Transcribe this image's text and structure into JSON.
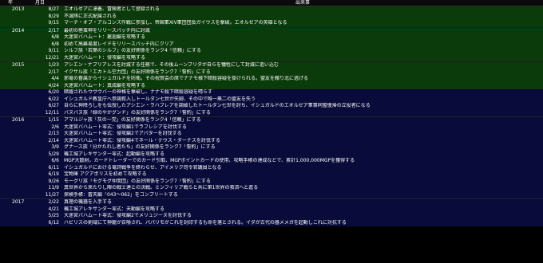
{
  "headers": {
    "year": "年",
    "date": "月日",
    "event": "出来事"
  },
  "colors": {
    "era_green": "#0b3a0b",
    "era_blue": "#090c3a",
    "background": "#000000"
  },
  "rows": [
    {
      "year": "2013",
      "date": "8/27",
      "event": "エオルゼアに漂着、冒険者として登録される",
      "era": "green"
    },
    {
      "year": "",
      "date": "8/29",
      "event": "不滅隊に正式配属される",
      "era": "green"
    },
    {
      "year": "",
      "date": "9/15",
      "event": "マーチ・オブ・アルコンズ作戦に参加し、帝国軍XIV軍団団長ガイウスを撃破。エオルゼアの英雄となる",
      "era": "green"
    },
    {
      "year": "2014",
      "date": "2/17",
      "event": "最初の極蛮神をリリースパッチ内に討滅",
      "era": "green"
    },
    {
      "year": "",
      "date": "6/8",
      "event": "大迷宮バハムート：邂逅編を攻略する",
      "era": "green"
    },
    {
      "year": "",
      "date": "6/8",
      "event": "初めて高難易度レイドをリリースパッチ内にクリア",
      "era": "green"
    },
    {
      "year": "",
      "date": "9/11",
      "event": "シルフ族「若葉のシルフ」の友好関係をランク4「信頼」にする",
      "era": "green"
    },
    {
      "year": "",
      "date": "12/21",
      "event": "大迷宮バハムート：侵攻編を攻略する",
      "era": "green"
    },
    {
      "year": "2015",
      "date": "1/23",
      "event": "アシエン・ナプリアレスを討滅する任務で、その後ムーンブリダが自らを犠牲にして封滅に追い込む",
      "era": "green"
    },
    {
      "year": "",
      "date": "2/17",
      "event": "イクサル族「エカトル空力団」の友好関係をランク7「誓約」にする",
      "era": "green"
    },
    {
      "year": "",
      "date": "4/4",
      "event": "邪竜の眷属からイシュガルドを防衛。その祝賀会の席でナナモ様下暗殺容疑を掛けられる。盟友を頼り北に逃げる",
      "era": "green"
    },
    {
      "year": "",
      "date": "4/24",
      "event": "大迷宮バハムート：真成編を攻略する",
      "era": "green"
    },
    {
      "year": "",
      "date": "6/20",
      "event": "暗躍されたウヴヴバーの神格を撃破し、ナナモ殺下暗殺容疑を晴らす",
      "era": "blue"
    },
    {
      "year": "",
      "date": "6/22",
      "event": "イシュガルド教皇庁へ参謁叙入しトールダン七世が失脚、その中で唯一無二の盟友を失う",
      "era": "blue"
    },
    {
      "year": "",
      "date": "6/27",
      "event": "自らに神降ろしをも伝授したアシエン・ラハブレアを調破したトールダン七世を討ち、イシュガルドのエオルゼア軍事同盟復帰の立役者になる",
      "era": "blue"
    },
    {
      "year": "",
      "date": "12/11",
      "event": "バヌバヌ族「緑のやかグンド」の友好関係をランク7「誓約」にする",
      "era": "blue"
    },
    {
      "year": "2016",
      "date": "1/15",
      "event": "アマルジャ族「灰の一党」の友好関係をランク4「信頼」にする",
      "era": "blue"
    },
    {
      "year": "",
      "date": "2/6",
      "event": "大迷宮バハムート零式：侵攻編1でラフレシアを討伐する",
      "era": "blue"
    },
    {
      "year": "",
      "date": "2/13",
      "event": "大迷宮バハムート零式：侵攻編2でアバターを討伐する",
      "era": "blue"
    },
    {
      "year": "",
      "date": "2/14",
      "event": "大迷宮バハムート零式：侵攻編4でネール・デウス・ダーナスを討伐する",
      "era": "blue"
    },
    {
      "year": "",
      "date": "3/9",
      "event": "グナース族「分かたれし者たち」の友好関係をランク7「誓約」にする",
      "era": "blue"
    },
    {
      "year": "",
      "date": "5/29",
      "event": "機工城アレキサンダー零式：起動編を攻略する",
      "era": "blue"
    },
    {
      "year": "",
      "date": "6/6",
      "event": "MGP大散財。カードトレーダーでのカード引取、MGPポイントカードの使用、攻略手帳の達成などで、累計1,000,000MGPを獲得する",
      "era": "blue"
    },
    {
      "year": "",
      "date": "6/11",
      "event": "イシュガルドにおける竜詩戦争を終わらせ、アイメリク司令官議員となる",
      "era": "blue"
    },
    {
      "year": "",
      "date": "6/19",
      "event": "宝物庫 アクアポリスを初めて攻略する",
      "era": "blue"
    },
    {
      "year": "",
      "date": "9/26",
      "event": "モーグリ族「モグモグ仲間団」の友好関係をランク7「誓約」にする",
      "era": "blue"
    },
    {
      "year": "",
      "date": "11/9",
      "event": "異世界から来たりし陣の戦士達との決戦。ミンフィリア戦らと共に第1世界の救済へと進る",
      "era": "blue"
    },
    {
      "year": "",
      "date": "11/27",
      "event": "探検手帳：蒼天編「043～062」をコンプリートする",
      "era": "blue"
    },
    {
      "year": "2017",
      "date": "2/22",
      "event": "真理の機器を入手する",
      "era": "blue"
    },
    {
      "year": "",
      "date": "4/21",
      "event": "機工城アレキサンダー零式：天動編を攻略する",
      "era": "blue"
    },
    {
      "year": "",
      "date": "5/25",
      "event": "大迷宮バハムート零式：侵攻編2でメリュジーヌを討伐する",
      "era": "blue"
    },
    {
      "year": "",
      "date": "6/12",
      "event": "ハビリスの剣域にて神龍が召喚され、パパリモがこれを封印するも命を落とされる。イダが古代の器メメガを起動しこれに対抗する",
      "era": "blue"
    }
  ]
}
